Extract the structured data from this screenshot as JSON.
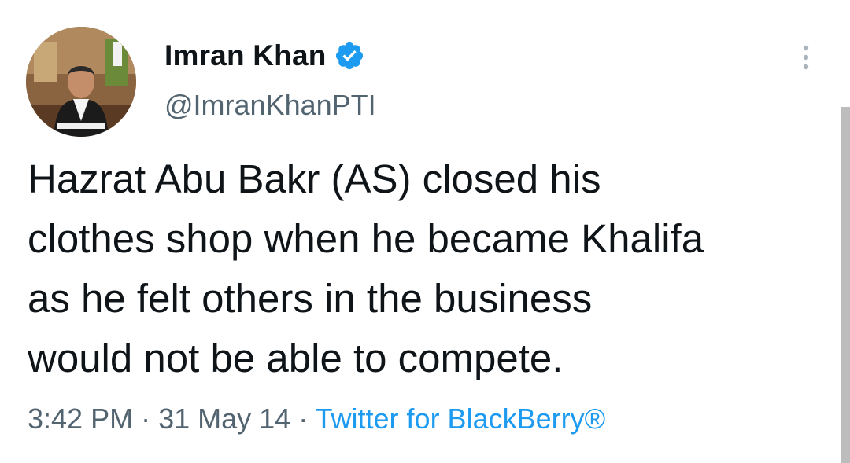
{
  "author": {
    "name": "Imran Khan",
    "handle": "@ImranKhanPTI",
    "verified": true,
    "avatar_icon": "profile-photo"
  },
  "tweet": {
    "lines": [
      "Hazrat Abu Bakr (AS) closed his",
      "clothes shop when he became Khalifa",
      "as he felt others in the business",
      "would not be able to compete."
    ]
  },
  "meta": {
    "time": "3:42 PM",
    "separator": " · ",
    "date": "31 May 14",
    "source": "Twitter for BlackBerry®"
  },
  "icons": {
    "verified": "verified-badge-icon",
    "more": "more-vertical-icon"
  },
  "colors": {
    "accent": "#1d9bf0",
    "secondary_text": "#536471",
    "primary_text": "#0f1419"
  }
}
